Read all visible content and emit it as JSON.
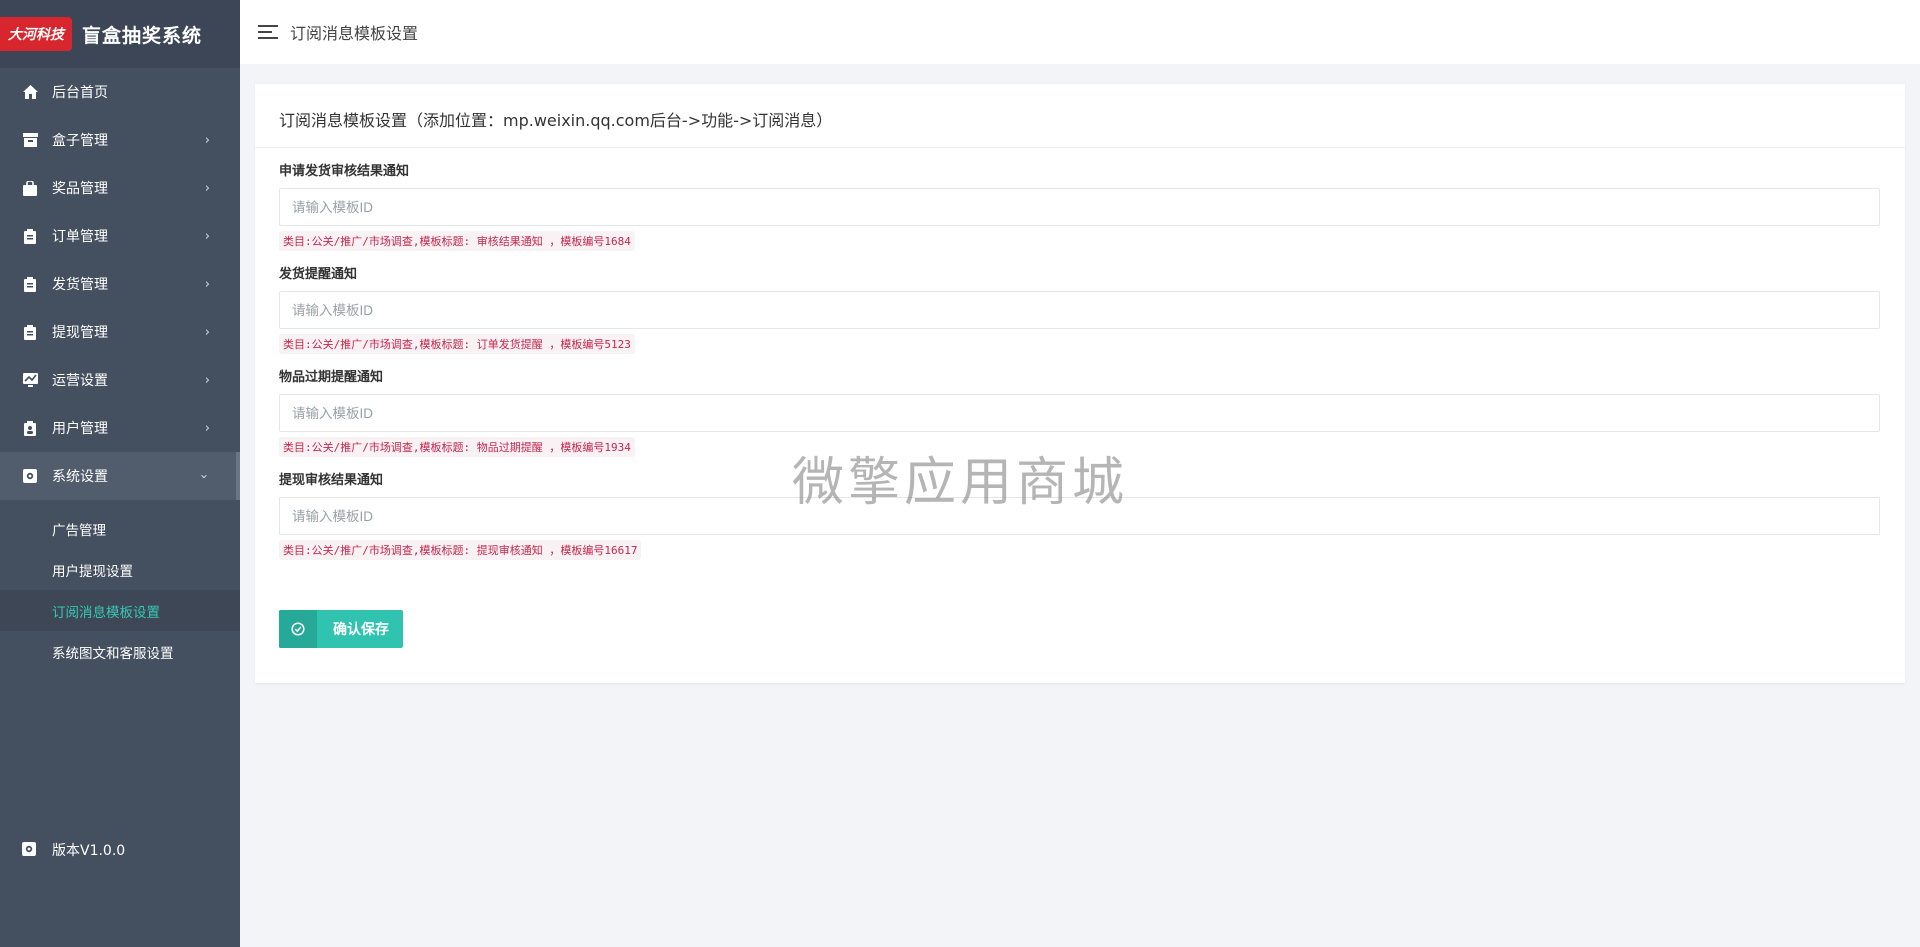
{
  "brand": {
    "logo_text": "大河科技",
    "title": "盲盒抽奖系统"
  },
  "sidebar": {
    "items": [
      {
        "label": "后台首页",
        "icon": "home-icon",
        "has_children": false
      },
      {
        "label": "盒子管理",
        "icon": "box-icon",
        "has_children": true
      },
      {
        "label": "奖品管理",
        "icon": "bag-icon",
        "has_children": true
      },
      {
        "label": "订单管理",
        "icon": "clipboard-icon",
        "has_children": true
      },
      {
        "label": "发货管理",
        "icon": "clipboard-icon",
        "has_children": true
      },
      {
        "label": "提现管理",
        "icon": "clipboard-icon",
        "has_children": true
      },
      {
        "label": "运营设置",
        "icon": "chart-icon",
        "has_children": true
      },
      {
        "label": "用户管理",
        "icon": "user-icon",
        "has_children": true
      },
      {
        "label": "系统设置",
        "icon": "gear-icon",
        "has_children": true,
        "open": true
      }
    ],
    "submenu": [
      {
        "label": "广告管理"
      },
      {
        "label": "用户提现设置"
      },
      {
        "label": "订阅消息模板设置",
        "active": true
      },
      {
        "label": "系统图文和客服设置"
      }
    ],
    "version": "版本V1.0.0"
  },
  "topbar": {
    "title": "订阅消息模板设置"
  },
  "card": {
    "title": "订阅消息模板设置（添加位置：mp.weixin.qq.com后台->功能->订阅消息）",
    "fields": [
      {
        "label": "申请发货审核结果通知",
        "placeholder": "请输入模板ID",
        "value": "",
        "hint": "类目:公关/推广/市场调查,模板标题: 审核结果通知 ，模板编号1684"
      },
      {
        "label": "发货提醒通知",
        "placeholder": "请输入模板ID",
        "value": "",
        "hint": "类目:公关/推广/市场调查,模板标题: 订单发货提醒 ，模板编号5123"
      },
      {
        "label": "物品过期提醒通知",
        "placeholder": "请输入模板ID",
        "value": "",
        "hint": "类目:公关/推广/市场调查,模板标题: 物品过期提醒 ，模板编号1934"
      },
      {
        "label": "提现审核结果通知",
        "placeholder": "请输入模板ID",
        "value": "",
        "hint": "类目:公关/推广/市场调查,模板标题: 提现审核通知 ，模板编号16617"
      }
    ],
    "save_label": "确认保存"
  },
  "watermark": "微擎应用商城",
  "colors": {
    "sidebar_bg": "#444f5f",
    "accent": "#2fc3b0",
    "hint_text": "#c7254e",
    "brand_red": "#d7262d"
  }
}
